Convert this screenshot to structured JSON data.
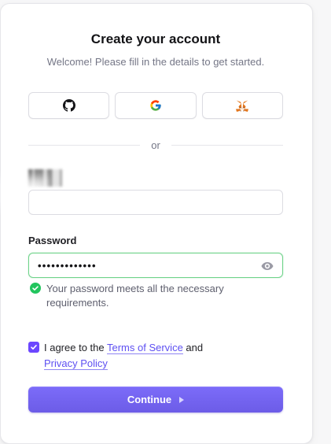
{
  "header": {
    "title": "Create your account",
    "subtitle": "Welcome! Please fill in the details to get started."
  },
  "social": {
    "buttons": [
      {
        "icon": "github-icon"
      },
      {
        "icon": "google-icon"
      },
      {
        "icon": "metamask-icon"
      }
    ]
  },
  "divider": {
    "label": "or"
  },
  "username": {
    "value": ""
  },
  "password": {
    "label": "Password",
    "value": "•••••••••••••",
    "validation": "Your password meets all the necessary requirements."
  },
  "terms": {
    "prefix": "I agree to the ",
    "terms_link": "Terms of Service",
    "middle": " and",
    "privacy_link": "Privacy Policy",
    "checked": true
  },
  "continue": {
    "label": "Continue"
  },
  "colors": {
    "accent": "#6c47ff",
    "success": "#22c55e",
    "link": "#5e50f2"
  }
}
